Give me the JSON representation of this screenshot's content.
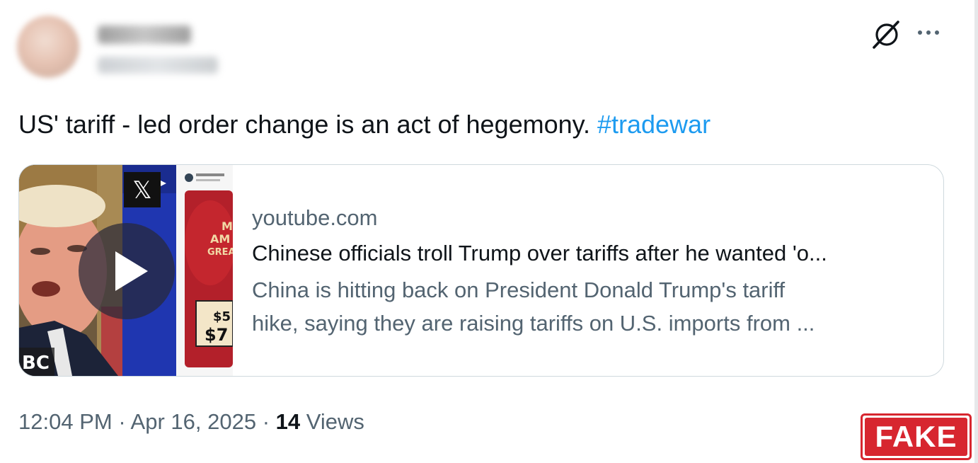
{
  "tweet": {
    "text": "US' tariff - led order change is an act of hegemony. ",
    "hashtag": "#tradewar",
    "time": "12:04 PM",
    "separator": " · ",
    "date": "Apr 16, 2025",
    "views_count": "14",
    "views_label": " Views",
    "hashtag_color": "#1d9bf0"
  },
  "icons": {
    "grok": "grok-icon",
    "more": "more-icon",
    "play": "play-icon"
  },
  "card": {
    "domain": "youtube.com",
    "title": "Chinese officials troll Trump over tariffs after he wanted 'o...",
    "description_line1": "China is hitting back on President Donald Trump's tariff",
    "description_line2": "hike, saying they are raising tariffs on U.S. imports from ...",
    "thumbnail": {
      "x_logo": "𝕏",
      "corner_text": "BC",
      "hat_text": [
        "M",
        "AM",
        "GREA"
      ],
      "price_text": [
        "$5",
        "$7"
      ]
    }
  },
  "stamp": {
    "label": "FAKE",
    "color": "#d7262f"
  }
}
